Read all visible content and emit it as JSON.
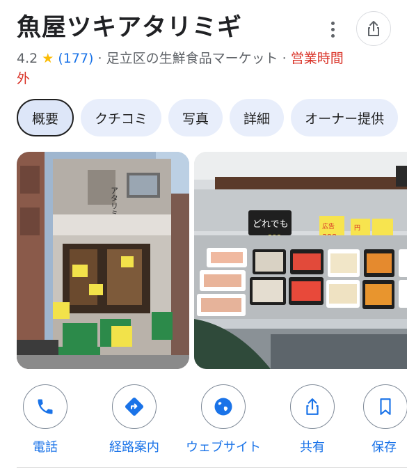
{
  "place": {
    "name": "魚屋ツキアタリミギ",
    "rating": "4.2",
    "review_count": "(177)",
    "category": "足立区の生鮮食品マーケット",
    "separator": "·",
    "status": "営業時間外"
  },
  "tabs": [
    {
      "label": "概要",
      "active": true
    },
    {
      "label": "クチコミ"
    },
    {
      "label": "写真"
    },
    {
      "label": "詳細"
    },
    {
      "label": "オーナー提供"
    }
  ],
  "photos": {
    "storefront_sign": "アタリミギ",
    "shelf_sign": "どれでも",
    "shelf_price": "298",
    "tag_prefix": "広告",
    "tag_yen": "円",
    "tag_price": "398"
  },
  "actions": [
    {
      "label": "電話",
      "icon": "phone-icon"
    },
    {
      "label": "経路案内",
      "icon": "directions-icon"
    },
    {
      "label": "ウェブサイト",
      "icon": "globe-icon"
    },
    {
      "label": "共有",
      "icon": "share-icon"
    },
    {
      "label": "保存",
      "icon": "bookmark-icon"
    }
  ],
  "colors": {
    "accent": "#1a73e8",
    "closed": "#d93025",
    "star": "#fbbc04",
    "chip_bg": "#e8eefb"
  }
}
